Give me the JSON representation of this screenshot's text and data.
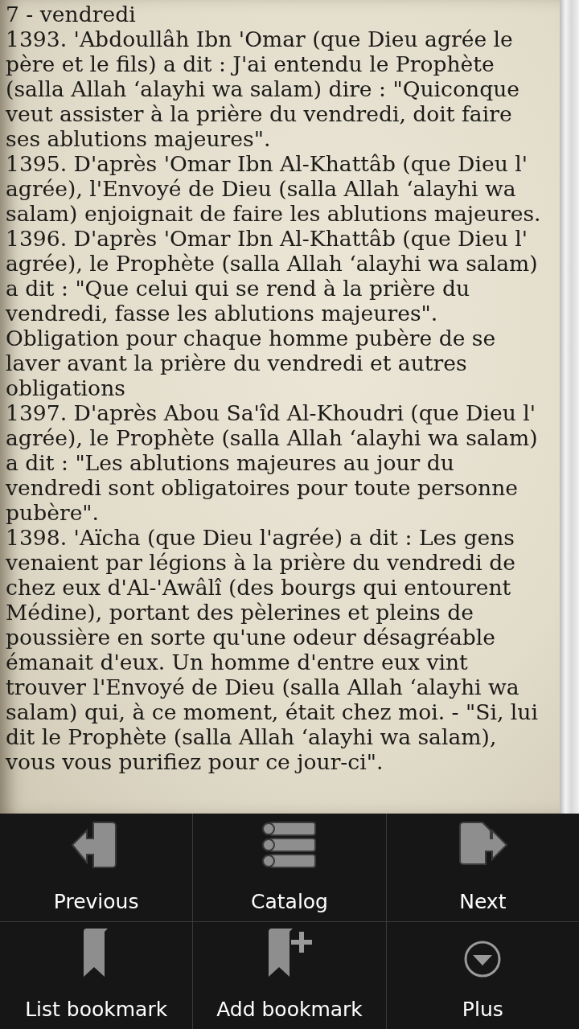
{
  "page": {
    "paragraphs": [
      "7 - vendredi",
      "1393. 'Abdoullâh Ibn 'Omar (que Dieu agrée le père et le fils) a dit : J'ai entendu le Prophète (salla Allah ‘alayhi wa salam) dire : \"Quiconque veut assister à la prière du vendredi, doit faire ses ablutions majeures\".",
      "1395. D'après 'Omar Ibn Al-Khattâb (que Dieu l' agrée), l'Envoyé de Dieu (salla Allah ‘alayhi wa salam) enjoignait de faire les ablutions majeures.",
      "1396. D'après 'Omar Ibn Al-Khattâb (que Dieu l' agrée), le Prophète (salla Allah ‘alayhi wa salam) a dit : \"Que celui qui se rend à la prière du vendredi, fasse les ablutions majeures\".",
      "Obligation pour chaque homme pubère de se laver avant la prière du vendredi et autres obligations",
      "1397. D'après Abou Sa'îd Al-Khoudri (que Dieu l' agrée), le Prophète (salla Allah ‘alayhi wa salam) a dit : \"Les ablutions majeures au jour du vendredi sont obligatoires pour toute personne pubère\".",
      "1398. 'Aïcha (que Dieu l'agrée) a dit : Les gens venaient par légions à la prière du vendredi de chez eux d'Al-'Awâlî (des bourgs qui entourent Médine), portant des pèlerines et pleins de poussière en sorte qu'une odeur désagréable émanait d'eux. Un homme d'entre eux vint trouver l'Envoyé de Dieu (salla Allah ‘alayhi wa salam) qui, à ce moment, était chez moi. - \"Si, lui dit le Prophète (salla Allah ‘alayhi wa salam), vous vous purifiez pour ce jour-ci\"."
    ]
  },
  "menu": {
    "items": [
      {
        "label": "Previous"
      },
      {
        "label": "Catalog"
      },
      {
        "label": "Next"
      },
      {
        "label": "List bookmark"
      },
      {
        "label": "Add bookmark"
      },
      {
        "label": "Plus"
      }
    ]
  }
}
